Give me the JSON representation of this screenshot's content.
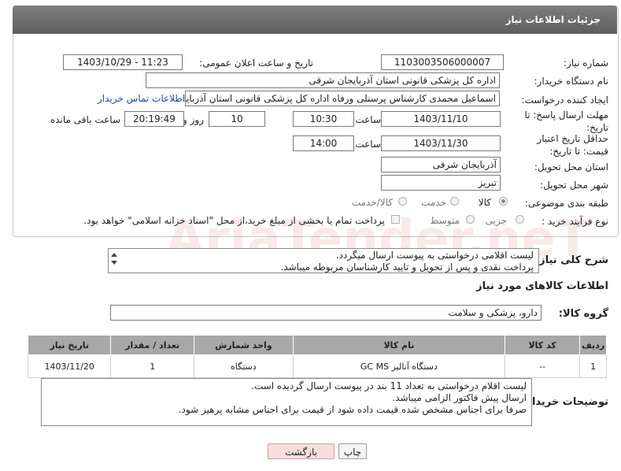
{
  "panel": {
    "title": "جزئیات اطلاعات نیاز"
  },
  "labels": {
    "need_number": "شماره نیاز:",
    "announce_datetime": "تاریخ و ساعت اعلان عمومی:",
    "buyer_org": "نام دستگاه خریدار:",
    "requester": "ایجاد کننده درخواست:",
    "reply_deadline": "مهلت ارسال پاسخ: تا تاریخ:",
    "price_validity": "حداقل تاریخ اعتبار قیمت: تا تاریخ:",
    "time": "ساعت",
    "day_and": "روز و",
    "hours_remaining": "ساعت باقی مانده",
    "delivery_province": "استان محل تحویل:",
    "delivery_city": "شهر محل تحویل:",
    "category": "طبقه بندی موضوعی:",
    "process_type": "نوع فرآیند خرید :",
    "general_description": "شرح کلی نیاز:",
    "goods_info_header": "اطلاعات کالاهای مورد نیاز",
    "goods_group": "گروه کالا:",
    "buyer_notes": "توضیحات خریدار:"
  },
  "fields": {
    "need_number": "1103003506000007",
    "announce_datetime": "1403/10/29 - 11:23",
    "buyer_org": "اداره کل پزشکی قانونی استان آذربایجان شرقی",
    "requester": "اسماعیل محمدی کارشناس پرسنلی ورفاه اداره کل پزشکی قانونی استان آذربایجان",
    "contact_link": "اطلاعات تماس خریدار",
    "reply_date": "1403/11/10",
    "reply_time": "10:30",
    "reply_days": "10",
    "reply_remaining": "20:19:49",
    "validity_date": "1403/11/30",
    "validity_time": "14:00",
    "province": "آذربایجان شرقی",
    "city": "تبریز"
  },
  "category_options": [
    "کالا",
    "خدمت",
    "کالا/خدمت"
  ],
  "category_selected": "کالا",
  "process_options": [
    "جزیی",
    "متوسط"
  ],
  "payment_note": "پرداخت تمام یا بخشی از مبلغ خرید،از محل \"اسناد خزانه اسلامی\" خواهد بود.",
  "general_description": [
    "لیست اقلامی درخواستی به پیوست ارسال میگردد.",
    "پرداخت نقدی و پس از تحویل و تایید کارشناسان مربوطه میباشد."
  ],
  "goods_group_value": "دارو، پزشکی و سلامت",
  "table": {
    "headers": [
      "ردیف",
      "کد کالا",
      "نام کالا",
      "واحد شمارش",
      "تعداد / مقدار",
      "تاریخ نیاز"
    ],
    "rows": [
      [
        "1",
        "--",
        "دستگاه آنالیز GC MS",
        "دستگاه",
        "1",
        "1403/11/20"
      ]
    ]
  },
  "buyer_notes": [
    "لیست اقلام درخواستی به تعداد 11 بند در پیوست ارسال گردیده است.",
    "ارسال پیش فاکتور الزامی میباشد.",
    "صرفا برای اجناس مشخص شده قیمت داده شود از قیمت برای اجناس مشابه پرهیز شود."
  ],
  "buttons": {
    "back": "بازگشت",
    "print": "چاپ"
  },
  "watermark_text": "AriaTender.neT"
}
